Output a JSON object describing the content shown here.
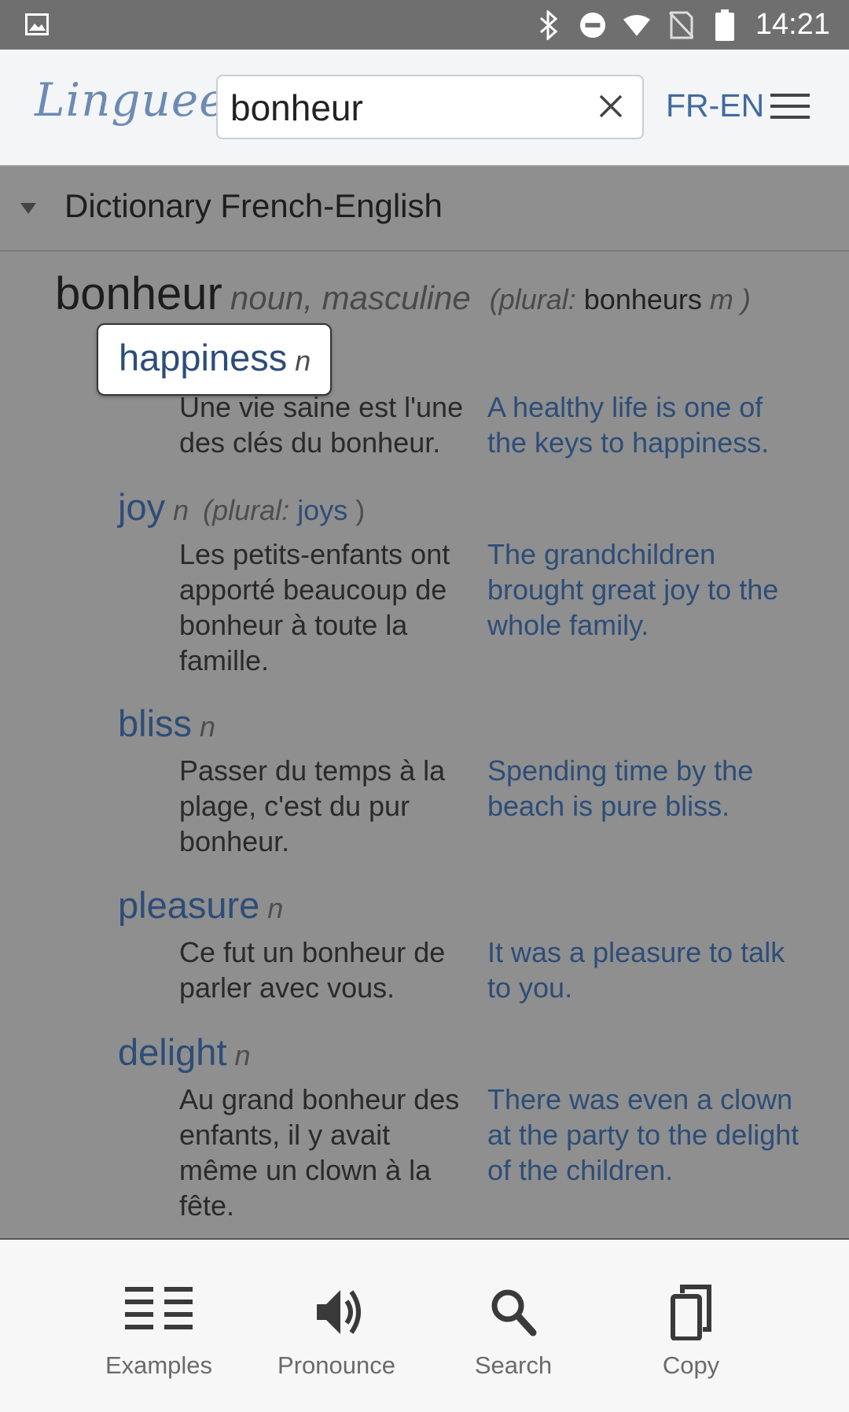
{
  "status_bar": {
    "time": "14:21"
  },
  "header": {
    "logo": "Linguee",
    "search": {
      "value": "bonheur",
      "placeholder": ""
    },
    "language_pair": "FR-EN"
  },
  "section": {
    "title": "Dictionary French-English"
  },
  "headword": {
    "word": "bonheur",
    "pos": "noun, masculine",
    "plural_label": "(plural:",
    "plural_word": "bonheurs",
    "plural_gender": "m )"
  },
  "translations": [
    {
      "word": "happiness",
      "pos": "n",
      "plural_label": "",
      "plural_word": "",
      "plural_close": "",
      "fr": "Une vie saine est l'une des clés du bonheur.",
      "en": "A healthy life is one of the keys to happiness."
    },
    {
      "word": "joy",
      "pos": "n",
      "plural_label": "(plural:",
      "plural_word": "joys",
      "plural_close": ")",
      "fr": "Les petits-enfants ont apporté beaucoup de bonheur à toute la famille.",
      "en": "The grandchildren brought great joy to the whole family."
    },
    {
      "word": "bliss",
      "pos": "n",
      "plural_label": "",
      "plural_word": "",
      "plural_close": "",
      "fr": "Passer du temps à la plage, c'est du pur bonheur.",
      "en": "Spending time by the beach is pure bliss."
    },
    {
      "word": "pleasure",
      "pos": "n",
      "plural_label": "",
      "plural_word": "",
      "plural_close": "",
      "fr": "Ce fut un bonheur de parler avec vous.",
      "en": "It was a pleasure to talk to you."
    },
    {
      "word": "delight",
      "pos": "n",
      "plural_label": "",
      "plural_word": "",
      "plural_close": "",
      "fr": "Au grand bonheur des enfants, il y avait même un clown à la fête.",
      "en": "There was even a clown at the party to the delight of the children."
    }
  ],
  "bottom_bar": {
    "examples": "Examples",
    "pronounce": "Pronounce",
    "search": "Search",
    "copy": "Copy"
  },
  "colors": {
    "accent": "#3f6b9f",
    "overlay": "#8f8f8f"
  }
}
